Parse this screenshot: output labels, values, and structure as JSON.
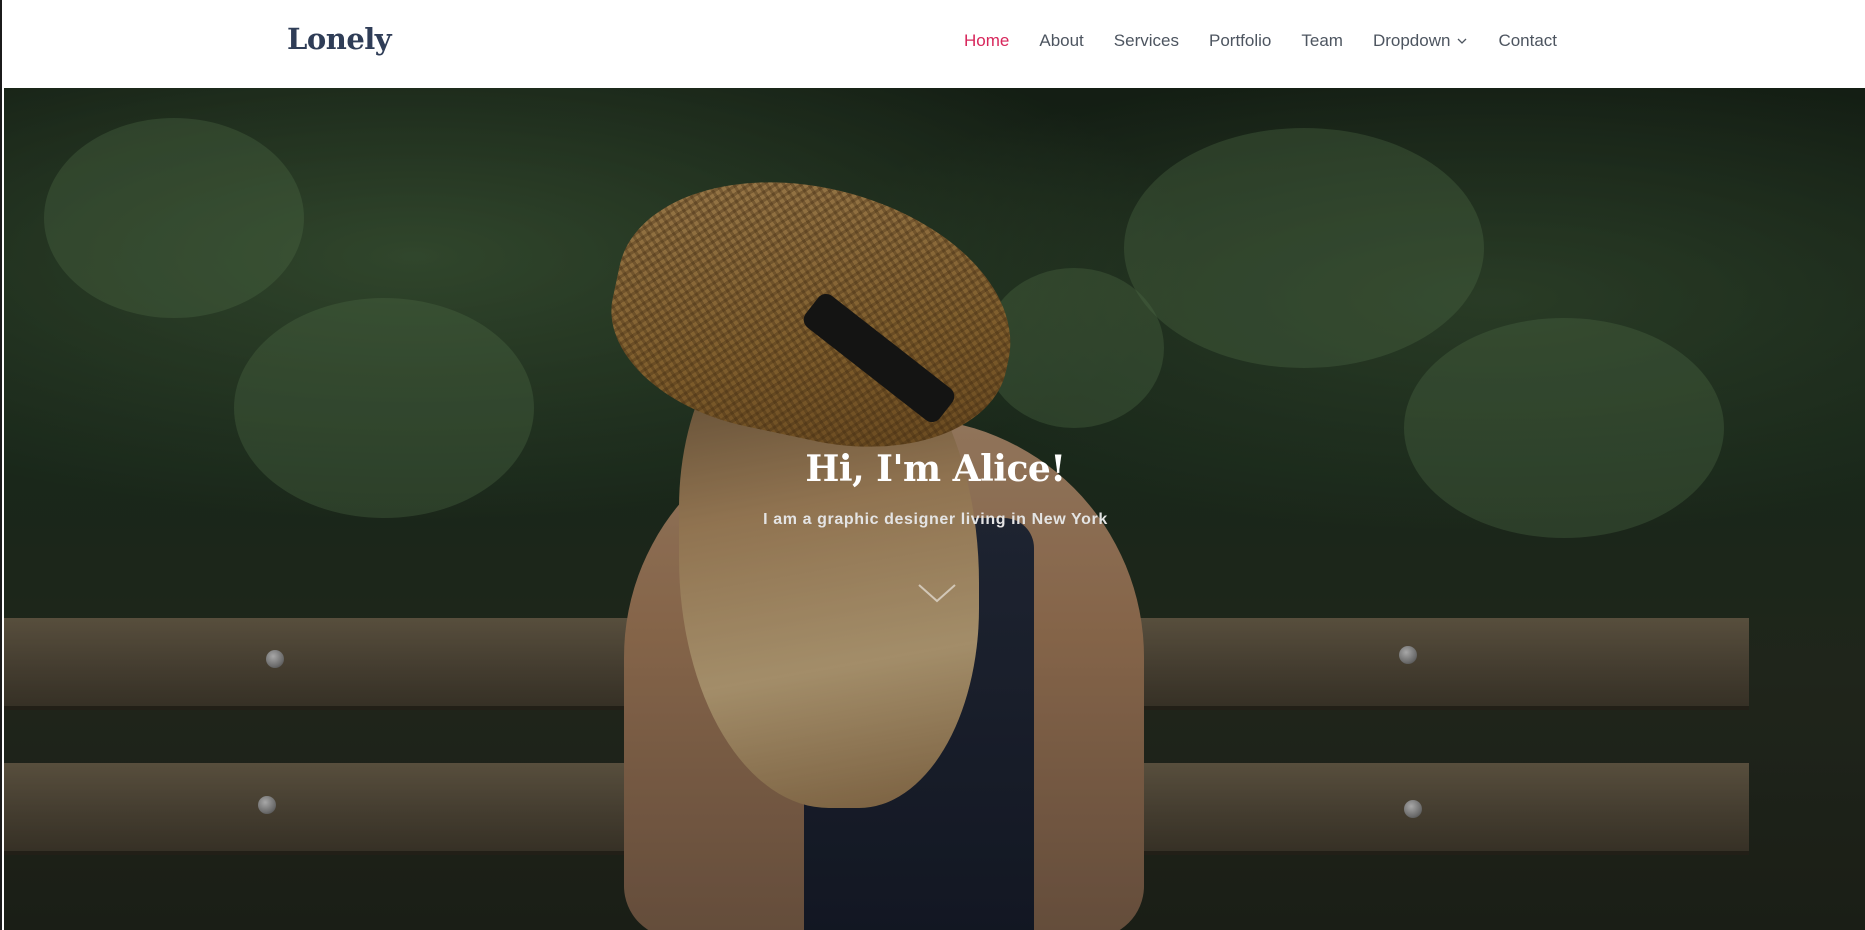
{
  "brand": {
    "name": "Lonely"
  },
  "nav": {
    "items": [
      {
        "label": "Home",
        "active": true
      },
      {
        "label": "About"
      },
      {
        "label": "Services"
      },
      {
        "label": "Portfolio"
      },
      {
        "label": "Team"
      },
      {
        "label": "Dropdown",
        "has_submenu": true,
        "icon": "chevron-down-icon"
      },
      {
        "label": "Contact"
      }
    ]
  },
  "hero": {
    "title": "Hi, I'm Alice!",
    "subtitle": "I am a graphic designer living in New York",
    "scroll_icon": "chevron-down-icon"
  },
  "colors": {
    "accent": "#d7265b",
    "brand_text": "#2f3d57",
    "nav_text": "#4d5560"
  }
}
